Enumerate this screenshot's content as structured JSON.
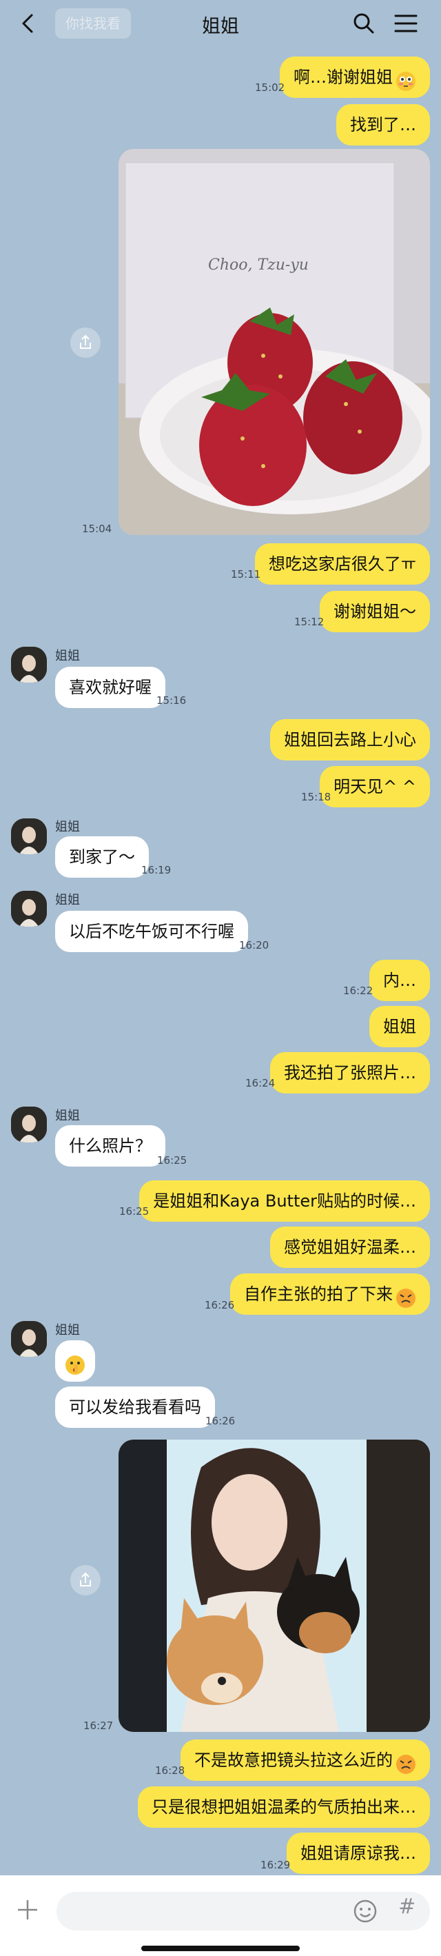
{
  "header": {
    "title": "姐姐",
    "ghost": "你找我看"
  },
  "contact": "姐姐",
  "messages": [
    {
      "text": "啊…谢谢姐姐",
      "time": "15:02"
    },
    {
      "text": "找到了…"
    },
    {
      "photo_card_text": "Choo, Tzu-yu",
      "time": "15:04"
    },
    {
      "text": "想吃这家店很久了ㅠ",
      "time": "15:11"
    },
    {
      "text": "谢谢姐姐～",
      "time": "15:12"
    },
    {
      "text": "喜欢就好喔",
      "time": "15:16"
    },
    {
      "text": "姐姐回去路上小心"
    },
    {
      "text": "明天见^ ^",
      "time": "15:18"
    },
    {
      "text": "到家了～",
      "time": "16:19"
    },
    {
      "text": "以后不吃午饭可不行喔",
      "time": "16:20"
    },
    {
      "text": "内…",
      "time": "16:22"
    },
    {
      "text": "姐姐"
    },
    {
      "text": "我还拍了张照片…",
      "time": "16:24"
    },
    {
      "text": "什么照片？",
      "time": "16:25"
    },
    {
      "text": "是姐姐和Kaya Butter贴贴的时候…",
      "time": "16:25"
    },
    {
      "text": "感觉姐姐好温柔…"
    },
    {
      "text": "自作主张的拍了下来",
      "time": "16:26"
    },
    {
      "text": "可以发给我看看吗",
      "time": "16:26"
    },
    {
      "time": "16:27"
    },
    {
      "text": "不是故意把镜头拉这么近的",
      "time": "16:28"
    },
    {
      "text": "只是很想把姐姐温柔的气质拍出来…"
    },
    {
      "text": "姐姐请原谅我…",
      "time": "16:29"
    }
  ],
  "input": {
    "hash": "#"
  },
  "colors": {
    "background": "#a9bfd3",
    "my_bubble": "#fbe54b",
    "their_bubble": "#ffffff"
  },
  "icons": [
    "back-icon",
    "search-icon",
    "menu-icon",
    "share-icon",
    "plus-icon",
    "emoji-icon",
    "hash-icon"
  ]
}
